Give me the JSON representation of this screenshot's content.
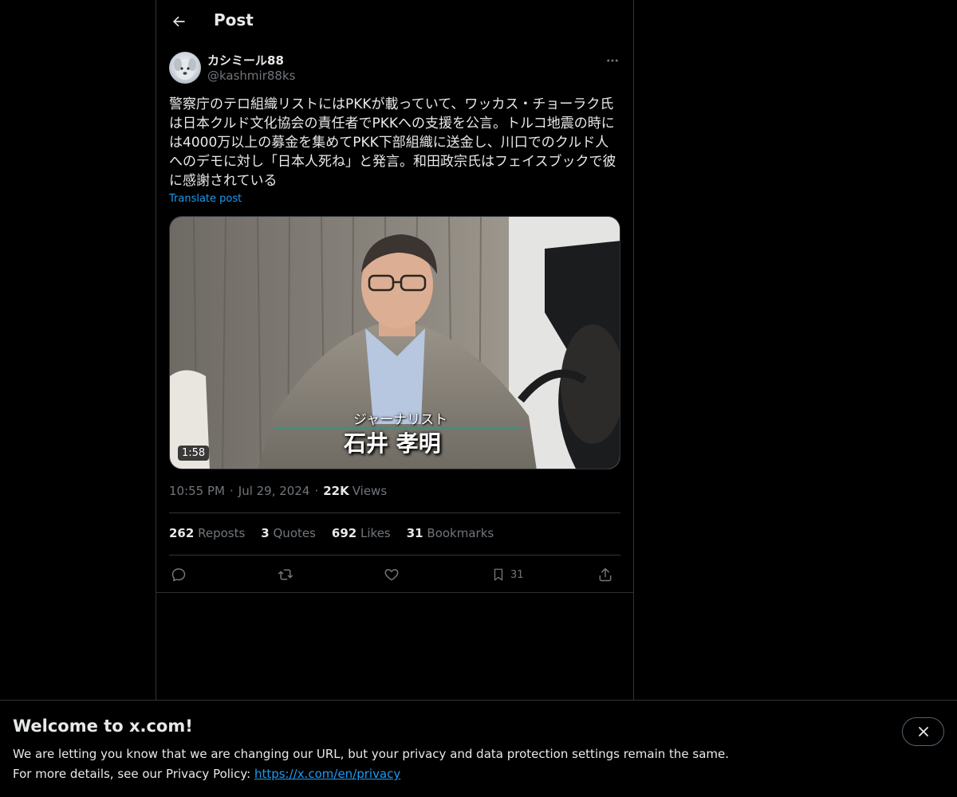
{
  "header": {
    "title": "Post"
  },
  "author": {
    "name": "カシミール88",
    "handle": "@kashmir88ks"
  },
  "post": {
    "text": "警察庁のテロ組織リストにはPKKが載っていて、ワッカス・チョーラク氏は日本クルド文化協会の責任者でPKKへの支援を公言。トルコ地震の時には4000万以上の募金を集めてPKK下部組織に送金し、川口でのクルド人へのデモに対し「日本人死ね」と発言。和田政宗氏はフェイスブックで彼に感謝されている",
    "translate_label": "Translate post"
  },
  "media": {
    "duration": "1:58",
    "caption_small": "ジャーナリスト",
    "caption_large": "石井 孝明"
  },
  "meta": {
    "time": "10:55 PM",
    "date": "Jul 29, 2024",
    "views_count": "22K",
    "views_label": "Views"
  },
  "stats": {
    "reposts_count": "262",
    "reposts_label": "Reposts",
    "quotes_count": "3",
    "quotes_label": "Quotes",
    "likes_count": "692",
    "likes_label": "Likes",
    "bookmarks_count": "31",
    "bookmarks_label": "Bookmarks"
  },
  "actions": {
    "bookmark_count": "31"
  },
  "banner": {
    "title": "Welcome to x.com!",
    "line1": "We are letting you know that we are changing our URL, but your privacy and data protection settings remain the same.",
    "line2_prefix": "For more details, see our Privacy Policy: ",
    "link": "https://x.com/en/privacy"
  },
  "colors": {
    "accent": "#1d9bf0",
    "background": "#000000",
    "border": "#2f3336",
    "muted": "#71767b",
    "text": "#e7e9ea"
  }
}
